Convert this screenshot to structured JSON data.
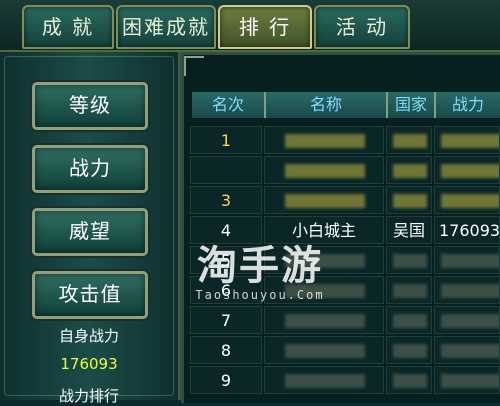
{
  "tabs": [
    {
      "label": "成 就",
      "active": false
    },
    {
      "label": "困难成就",
      "active": false
    },
    {
      "label": "排 行",
      "active": true
    },
    {
      "label": "活 动",
      "active": false
    }
  ],
  "categories": [
    "等级",
    "战力",
    "威望",
    "攻击值"
  ],
  "self": {
    "label": "自身战力",
    "value": "176093",
    "rank_label": "战力排行"
  },
  "table": {
    "headers": [
      "名次",
      "名称",
      "国家",
      "战力"
    ],
    "rows": [
      {
        "rank": "1",
        "name": "",
        "nation": "",
        "power": "",
        "highlight": true
      },
      {
        "rank": "",
        "name": "",
        "nation": "",
        "power": "",
        "highlight": true
      },
      {
        "rank": "3",
        "name": "",
        "nation": "",
        "power": "",
        "highlight": true
      },
      {
        "rank": "4",
        "name": "小白城主",
        "nation": "吴国",
        "power": "176093",
        "highlight": false
      },
      {
        "rank": "5",
        "name": "",
        "nation": "",
        "power": "",
        "highlight": false
      },
      {
        "rank": "6",
        "name": "",
        "nation": "",
        "power": "",
        "highlight": false
      },
      {
        "rank": "7",
        "name": "",
        "nation": "",
        "power": "",
        "highlight": false
      },
      {
        "rank": "8",
        "name": "",
        "nation": "",
        "power": "",
        "highlight": false
      },
      {
        "rank": "9",
        "name": "",
        "nation": "",
        "power": "",
        "highlight": false
      }
    ]
  },
  "watermark": {
    "main": "淘手游",
    "sub": "Taoshouyou.Com"
  },
  "colors": {
    "gold_text": "#ffd34d",
    "yellow_value": "#e8ff3a",
    "header_text": "#7fdcff"
  }
}
